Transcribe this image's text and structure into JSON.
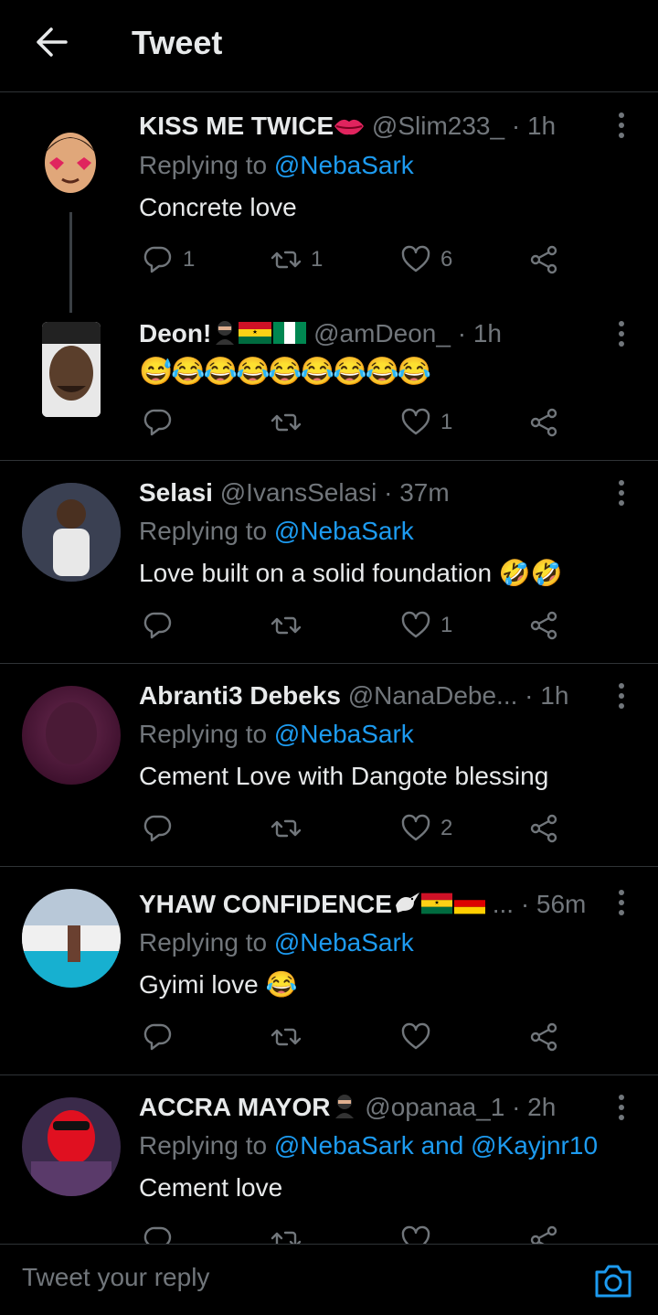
{
  "header": {
    "title": "Tweet"
  },
  "replying_prefix": "Replying to",
  "tweets": [
    {
      "name": "KISS ME TWICE",
      "handle": "@Slim233_",
      "time": "· 1h",
      "reply_to": "@NebaSark",
      "text": "Concrete love",
      "replies": "1",
      "retweets": "1",
      "likes": "6"
    },
    {
      "name": "Deon!",
      "handle": "@amDeon_",
      "time": "· 1h",
      "text": "😅😂😂😂😂😂😂😂😂",
      "replies": "",
      "retweets": "",
      "likes": "1"
    },
    {
      "name": "Selasi",
      "handle": "@IvansSelasi",
      "time": "· 37m",
      "reply_to": "@NebaSark",
      "text": "Love built on a solid foundation 🤣🤣",
      "replies": "",
      "retweets": "",
      "likes": "1"
    },
    {
      "name": "Abranti3 Debeks",
      "handle": "@NanaDebe...",
      "time": "· 1h",
      "reply_to": "@NebaSark",
      "text": "Cement Love with Dangote blessing",
      "replies": "",
      "retweets": "",
      "likes": "2"
    },
    {
      "name": "YHAW CONFIDENCE",
      "handle": "...",
      "time": "· 56m",
      "reply_to": "@NebaSark",
      "text": "Gyimi love 😂",
      "replies": "",
      "retweets": "",
      "likes": ""
    },
    {
      "name": "ACCRA MAYOR",
      "handle": "@opanaa_1",
      "time": "· 2h",
      "reply_to": "@NebaSark",
      "reply_and": "and",
      "reply_to2": "@Kayjnr10",
      "text": "Cement love"
    }
  ],
  "composer": {
    "placeholder": "Tweet your reply"
  },
  "colors": {
    "background": "#000000",
    "accent": "#1d9bf0",
    "muted": "#71767b",
    "text": "#e7e9ea",
    "divider": "#2f3336"
  }
}
